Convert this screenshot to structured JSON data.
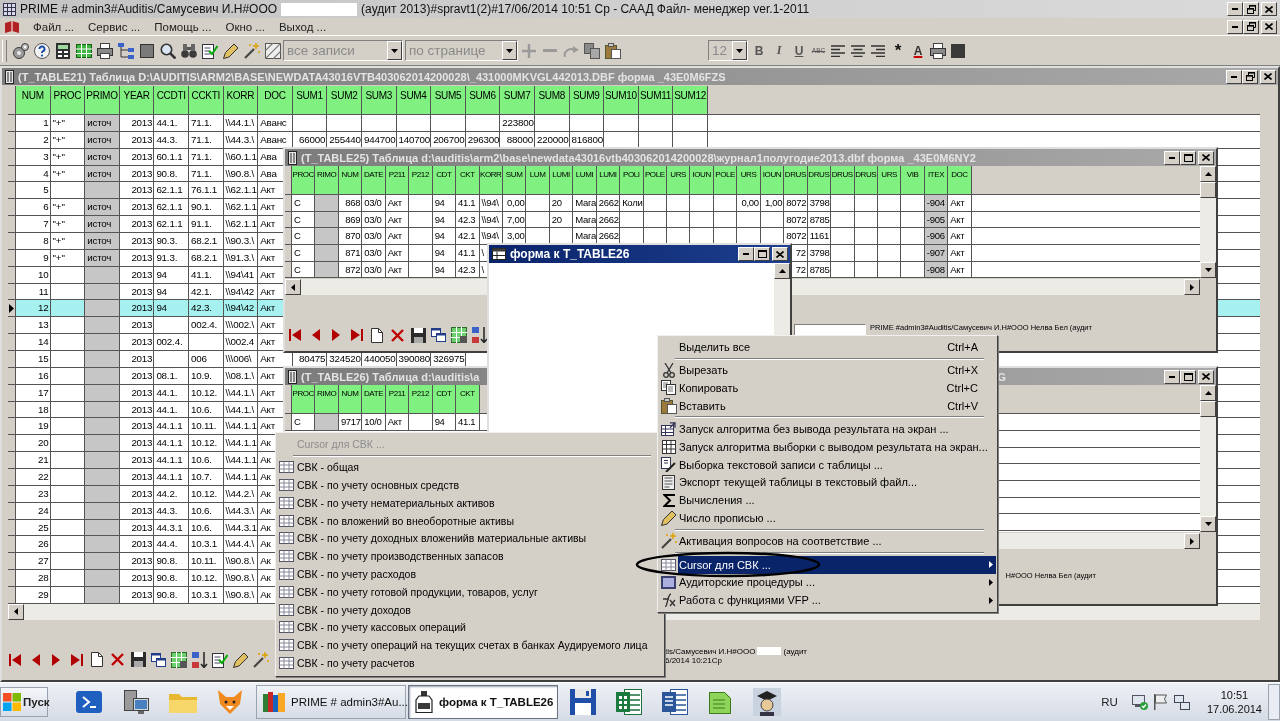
{
  "app": {
    "title_parts": [
      "PRIME # admin3#Auditis/Самусевич И.Н#ООО",
      "(аудит 2013)#spravt1(2)#17/06/2014 10:51 Ср - СААД Файл- менеджер ver.1-2011"
    ],
    "menu": [
      "Файл ...",
      "Сервис ...",
      "Помощь ...",
      "Окно ...",
      "Выход ..."
    ],
    "toolbar": {
      "record_filter": {
        "value": "все записи",
        "disabled": true
      },
      "paging": {
        "value": "по странице",
        "disabled": true
      },
      "font_size": {
        "value": "12",
        "disabled": true
      },
      "format_buttons": [
        {
          "label": "B",
          "kind": "bold"
        },
        {
          "label": "I",
          "kind": "italic"
        },
        {
          "label": "U",
          "kind": "underline"
        },
        {
          "label": "ABC",
          "kind": "strikethrough"
        }
      ],
      "symbol_button": "*",
      "font_color_button": "A"
    }
  },
  "table21": {
    "title": "(T_TABLE21) Таблица D:\\AUDITIS\\ARM2\\BASE\\NEWDATA43016VTB403062014200028\\_431000MKVGL442013.DBF форма _43E0M6FZS",
    "columns": [
      {
        "label": "NUM",
        "kind": "number"
      },
      {
        "label": "PROC",
        "kind": "text"
      },
      {
        "label": "PRIMO",
        "kind": "locked"
      },
      {
        "label": "YEAR",
        "kind": "number"
      },
      {
        "label": "CCDTI",
        "kind": "text"
      },
      {
        "label": "CCKTI",
        "kind": "text"
      },
      {
        "label": "KORR",
        "kind": "text"
      },
      {
        "label": "DOC",
        "kind": "text"
      },
      {
        "label": "SUM1",
        "kind": "number"
      },
      {
        "label": "SUM2",
        "kind": "number"
      },
      {
        "label": "SUM3",
        "kind": "number"
      },
      {
        "label": "SUM4",
        "kind": "number"
      },
      {
        "label": "SUM5",
        "kind": "number"
      },
      {
        "label": "SUM6",
        "kind": "number"
      },
      {
        "label": "SUM7",
        "kind": "number"
      },
      {
        "label": "SUM8",
        "kind": "number"
      },
      {
        "label": "SUM9",
        "kind": "number"
      },
      {
        "label": "SUM10",
        "kind": "number"
      },
      {
        "label": "SUM11",
        "kind": "number"
      },
      {
        "label": "SUM12",
        "kind": "number"
      }
    ],
    "rows": [
      {
        "selected": false,
        "cells": [
          "1",
          "\"+\"",
          "источ",
          "2013",
          "44.1.",
          "71.1.",
          "\\\\44.1.\\",
          "Аванс",
          "",
          "",
          "",
          "",
          "",
          "",
          "223800",
          "",
          "",
          "",
          "",
          ""
        ]
      },
      {
        "selected": false,
        "cells": [
          "2",
          "\"+\"",
          "источ",
          "2013",
          "44.3.",
          "71.1.",
          "\\\\44.3.\\",
          "Аванс",
          "66000",
          "255440",
          "944700",
          "140700",
          "206700",
          "296300",
          "88000",
          "220000",
          "816800",
          "",
          "",
          ""
        ]
      },
      {
        "selected": false,
        "cells": [
          "3",
          "\"+\"",
          "источ",
          "2013",
          "60.1.1",
          "71.1.",
          "\\\\60.1.1",
          "Ава",
          "",
          "",
          "",
          "",
          "",
          "",
          "",
          "",
          "",
          "",
          "",
          ""
        ]
      },
      {
        "selected": false,
        "cells": [
          "4",
          "\"+\"",
          "источ",
          "2013",
          "90.8.",
          "71.1.",
          "\\\\90.8.\\",
          "Ава",
          "",
          "",
          "",
          "",
          "",
          "",
          "",
          "",
          "",
          "",
          "",
          ""
        ]
      },
      {
        "selected": false,
        "cells": [
          "5",
          "",
          "",
          "2013",
          "62.1.1",
          "76.1.1",
          "\\\\62.1.1",
          "Акт",
          "",
          "",
          "",
          "",
          "",
          "",
          "",
          "",
          "",
          "",
          "",
          ""
        ]
      },
      {
        "selected": false,
        "cells": [
          "6",
          "\"+\"",
          "источ",
          "2013",
          "62.1.1",
          "90.1.",
          "\\\\62.1.1",
          "Акт",
          "",
          "",
          "",
          "",
          "",
          "",
          "",
          "",
          "",
          "",
          "",
          ""
        ]
      },
      {
        "selected": false,
        "cells": [
          "7",
          "\"+\"",
          "источ",
          "2013",
          "62.1.1",
          "91.1.",
          "\\\\62.1.1",
          "Акт",
          "",
          "",
          "",
          "",
          "",
          "",
          "",
          "",
          "",
          "",
          "",
          ""
        ]
      },
      {
        "selected": false,
        "cells": [
          "8",
          "\"+\"",
          "источ",
          "2013",
          "90.3.",
          "68.2.1",
          "\\\\90.3.\\",
          "Акт",
          "",
          "",
          "",
          "",
          "",
          "",
          "",
          "",
          "",
          "",
          "",
          ""
        ]
      },
      {
        "selected": false,
        "cells": [
          "9",
          "\"+\"",
          "источ",
          "2013",
          "91.3.",
          "68.2.1",
          "\\\\91.3.\\",
          "Акт",
          "",
          "",
          "",
          "",
          "",
          "",
          "",
          "",
          "",
          "",
          "",
          ""
        ]
      },
      {
        "selected": false,
        "cells": [
          "10",
          "",
          "",
          "2013",
          "94",
          "41.1.",
          "\\\\94\\41",
          "Акт",
          "",
          "",
          "",
          "",
          "",
          "",
          "",
          "",
          "",
          "",
          "",
          ""
        ]
      },
      {
        "selected": false,
        "cells": [
          "11",
          "",
          "",
          "2013",
          "94",
          "42.1.",
          "\\\\94\\42",
          "Акт",
          "",
          "",
          "",
          "",
          "",
          "",
          "",
          "",
          "",
          "",
          "",
          ""
        ]
      },
      {
        "selected": true,
        "cells": [
          "12",
          "",
          "",
          "2013",
          "94",
          "42.3.",
          "\\\\94\\42",
          "Акт",
          "",
          "",
          "",
          "",
          "",
          "",
          "",
          "",
          "",
          "",
          "",
          ""
        ]
      },
      {
        "selected": false,
        "cells": [
          "13",
          "",
          "",
          "2013",
          "",
          "002.4.",
          "\\\\\\002.\\",
          "Акт",
          "",
          "",
          "",
          "",
          "",
          "",
          "",
          "",
          "",
          "",
          "",
          ""
        ]
      },
      {
        "selected": false,
        "cells": [
          "14",
          "",
          "",
          "2013",
          "002.4.",
          "",
          "\\\\002.4",
          "Акт",
          "",
          "",
          "",
          "",
          "",
          "",
          "",
          "",
          "",
          "",
          "",
          ""
        ]
      },
      {
        "selected": false,
        "cells": [
          "15",
          "",
          "",
          "2013",
          "",
          "006",
          "\\\\\\006\\",
          "Акт",
          "80475",
          "324520",
          "440050",
          "390080",
          "326975",
          "",
          "",
          "",
          "",
          "",
          "",
          ""
        ]
      },
      {
        "selected": false,
        "cells": [
          "16",
          "",
          "",
          "2013",
          "08.1.",
          "10.9.",
          "\\\\08.1.\\",
          "Акт",
          "",
          "",
          "",
          "",
          "",
          "",
          "",
          "",
          "",
          "",
          "",
          ""
        ]
      },
      {
        "selected": false,
        "cells": [
          "17",
          "",
          "",
          "2013",
          "44.1.",
          "10.12.",
          "\\\\44.1.\\",
          "Акт",
          "",
          "",
          "",
          "",
          "",
          "",
          "",
          "",
          "",
          "",
          "",
          ""
        ]
      },
      {
        "selected": false,
        "cells": [
          "18",
          "",
          "",
          "2013",
          "44.1.",
          "10.6.",
          "\\\\44.1.\\",
          "Акт",
          "",
          "",
          "",
          "",
          "",
          "",
          "",
          "",
          "",
          "",
          "",
          ""
        ]
      },
      {
        "selected": false,
        "cells": [
          "19",
          "",
          "",
          "2013",
          "44.1.1",
          "10.11.",
          "\\\\44.1.1",
          "Акт",
          "",
          "",
          "",
          "",
          "",
          "",
          "",
          "",
          "",
          "",
          "",
          ""
        ]
      },
      {
        "selected": false,
        "cells": [
          "20",
          "",
          "",
          "2013",
          "44.1.1",
          "10.12.",
          "\\\\44.1.1",
          "Ак",
          "",
          "",
          "",
          "",
          "",
          "",
          "",
          "",
          "",
          "",
          "",
          ""
        ]
      },
      {
        "selected": false,
        "cells": [
          "21",
          "",
          "",
          "2013",
          "44.1.1",
          "10.6.",
          "\\\\44.1.1",
          "Ак",
          "",
          "",
          "",
          "",
          "",
          "",
          "",
          "",
          "",
          "",
          "",
          ""
        ]
      },
      {
        "selected": false,
        "cells": [
          "22",
          "",
          "",
          "2013",
          "44.1.1",
          "10.7.",
          "\\\\44.1.1",
          "Ак",
          "",
          "",
          "",
          "",
          "",
          "",
          "",
          "",
          "",
          "",
          "",
          ""
        ]
      },
      {
        "selected": false,
        "cells": [
          "23",
          "",
          "",
          "2013",
          "44.2.",
          "10.12.",
          "\\\\44.2.\\",
          "Ак",
          "",
          "",
          "",
          "",
          "",
          "",
          "",
          "",
          "",
          "",
          "",
          ""
        ]
      },
      {
        "selected": false,
        "cells": [
          "24",
          "",
          "",
          "2013",
          "44.3.",
          "10.6.",
          "\\\\44.3.\\",
          "Ак",
          "",
          "",
          "",
          "",
          "",
          "",
          "",
          "",
          "",
          "",
          "",
          ""
        ]
      },
      {
        "selected": false,
        "cells": [
          "25",
          "",
          "",
          "2013",
          "44.3.1",
          "10.6.",
          "\\\\44.3.1",
          "Ак",
          "",
          "",
          "",
          "",
          "",
          "",
          "",
          "",
          "",
          "",
          "",
          ""
        ]
      },
      {
        "selected": false,
        "cells": [
          "26",
          "",
          "",
          "2013",
          "44.4.",
          "10.3.1",
          "\\\\44.4.\\",
          "Ак",
          "",
          "",
          "",
          "",
          "",
          "",
          "",
          "",
          "",
          "",
          "",
          ""
        ]
      },
      {
        "selected": false,
        "cells": [
          "27",
          "",
          "",
          "2013",
          "90.8.",
          "10.11.",
          "\\\\90.8.\\",
          "Ак",
          "",
          "",
          "",
          "",
          "",
          "",
          "",
          "",
          "",
          "",
          "",
          ""
        ]
      },
      {
        "selected": false,
        "cells": [
          "28",
          "",
          "",
          "2013",
          "90.8.",
          "10.12.",
          "\\\\90.8.\\",
          "Ак",
          "",
          "",
          "",
          "",
          "",
          "",
          "",
          "",
          "",
          "",
          "",
          ""
        ]
      },
      {
        "selected": false,
        "cells": [
          "29",
          "",
          "",
          "2013",
          "90.8.",
          "10.3.1",
          "\\\\90.8.\\",
          "Ак",
          "",
          "",
          "",
          "",
          "",
          "",
          "",
          "",
          "",
          "",
          "",
          ""
        ]
      }
    ],
    "status_parts": [
      "tis/Самусевич И.Н#ООО",
      "(аудит",
      "6/2014 10:21Ср"
    ]
  },
  "table25": {
    "title": "(T_TABLE25) Таблица d:\\auditis\\arm2\\base\\newdata43016vtb403062014200028\\журнал1полугодие2013.dbf форма _43E0M6NY2",
    "columns": [
      {
        "label": "PROC",
        "kind": "text"
      },
      {
        "label": "RIMO",
        "kind": "locked"
      },
      {
        "label": "NUM",
        "kind": "number"
      },
      {
        "label": "DATE",
        "kind": "text"
      },
      {
        "label": "P211",
        "kind": "text"
      },
      {
        "label": "P212",
        "kind": "text"
      },
      {
        "label": "CDT",
        "kind": "text"
      },
      {
        "label": "CKT",
        "kind": "text"
      },
      {
        "label": "KORR",
        "kind": "text"
      },
      {
        "label": "SUM",
        "kind": "number"
      },
      {
        "label": "LUM",
        "kind": "text"
      },
      {
        "label": "LUMI",
        "kind": "text"
      },
      {
        "label": "LUMI",
        "kind": "text"
      },
      {
        "label": "LUMI",
        "kind": "text"
      },
      {
        "label": "POLI",
        "kind": "text"
      },
      {
        "label": "POLE",
        "kind": "text"
      },
      {
        "label": "URS",
        "kind": "text"
      },
      {
        "label": "IOUN",
        "kind": "text"
      },
      {
        "label": "POLE",
        "kind": "text"
      },
      {
        "label": "URS",
        "kind": "number"
      },
      {
        "label": "IOUN",
        "kind": "number"
      },
      {
        "label": "DRUS",
        "kind": "number"
      },
      {
        "label": "DRUS",
        "kind": "number"
      },
      {
        "label": "DRUS",
        "kind": "number"
      },
      {
        "label": "DRUS",
        "kind": "number"
      },
      {
        "label": "URS",
        "kind": "text"
      },
      {
        "label": "VIB",
        "kind": "text"
      },
      {
        "label": "ITEX",
        "kind": "locked"
      },
      {
        "label": "DOC",
        "kind": "text"
      }
    ],
    "rows": [
      [
        "С",
        "",
        "868",
        "03/0",
        "Акт",
        "",
        "94",
        "41.1",
        "\\\\94\\",
        "0,00",
        "",
        "20",
        "Мага",
        "2662",
        "Коли",
        "",
        "",
        "",
        "",
        "0,00",
        "1,00",
        "8072",
        "3798",
        "",
        "",
        "",
        "",
        "-904",
        "Акт"
      ],
      [
        "С",
        "",
        "869",
        "03/0",
        "Акт",
        "",
        "94",
        "42.3",
        "\\\\94\\",
        "7,00",
        "",
        "20",
        "Мага",
        "2662",
        "",
        "",
        "",
        "",
        "",
        "",
        "",
        "8072",
        "8785",
        "",
        "",
        "",
        "",
        "-905",
        "Акт"
      ],
      [
        "С",
        "",
        "870",
        "03/0",
        "Акт",
        "",
        "94",
        "42.1",
        "\\\\94\\",
        "3,00",
        "",
        "",
        "Мага",
        "2662",
        "",
        "",
        "",
        "",
        "",
        "",
        "",
        "8072",
        "1161",
        "",
        "",
        "",
        "",
        "-906",
        "Акт"
      ],
      [
        "С",
        "",
        "871",
        "03/0",
        "Акт",
        "",
        "94",
        "41.1",
        "\\",
        "",
        "",
        "",
        "",
        "",
        "",
        "",
        "",
        "",
        "",
        "",
        "",
        "72",
        "3798",
        "",
        "",
        "",
        "",
        "-907",
        "Акт"
      ],
      [
        "С",
        "",
        "872",
        "03/0",
        "Акт",
        "",
        "94",
        "42.3",
        "\\",
        "",
        "",
        "",
        "",
        "",
        "",
        "",
        "",
        "",
        "",
        "",
        "",
        "72",
        "8785",
        "",
        "",
        "",
        "",
        "-908",
        "Акт"
      ]
    ],
    "status": "PRIME #admin3#Auditis/Самусевич И.Н#ООО Нелва Бел (аудит"
  },
  "table26": {
    "title_parts": [
      "(T_TABLE26) Таблица d:\\auditis\\a",
      "G"
    ],
    "columns": [
      {
        "label": "PROC",
        "kind": "text"
      },
      {
        "label": "RIMO",
        "kind": "locked"
      },
      {
        "label": "NUM",
        "kind": "number"
      },
      {
        "label": "DATE",
        "kind": "text"
      },
      {
        "label": "P211",
        "kind": "text"
      },
      {
        "label": "P212",
        "kind": "text"
      },
      {
        "label": "CDT",
        "kind": "text"
      },
      {
        "label": "CKT",
        "kind": "text"
      }
    ],
    "rows": [
      [
        "С",
        "",
        "9717",
        "10/0",
        "Акт",
        "",
        "94",
        "41.1"
      ]
    ],
    "status": "Н#ООО Нелва Бел (аудит"
  },
  "form": {
    "title": "форма к T_TABLE26"
  },
  "context_menu": {
    "items": [
      {
        "kind": "item",
        "label": "Выделить все",
        "shortcut": "Ctrl+A",
        "selected": false,
        "submenu": false
      },
      {
        "kind": "separator"
      },
      {
        "kind": "item",
        "label": "Вырезать",
        "shortcut": "Ctrl+X",
        "selected": false,
        "submenu": false
      },
      {
        "kind": "item",
        "label": "Копировать",
        "shortcut": "Ctrl+C",
        "selected": false,
        "submenu": false
      },
      {
        "kind": "item",
        "label": "Вставить",
        "shortcut": "Ctrl+V",
        "selected": false,
        "submenu": false
      },
      {
        "kind": "separator"
      },
      {
        "kind": "item",
        "label": "Запуск алгоритма без вывода результата на экран ...",
        "selected": false,
        "submenu": false
      },
      {
        "kind": "item",
        "label": "Запуск алгоритма выборки с выводом результата на экран...",
        "selected": false,
        "submenu": false
      },
      {
        "kind": "item",
        "label": "Выборка текстовой записи с таблицы ...",
        "selected": false,
        "submenu": false
      },
      {
        "kind": "item",
        "label": "Экспорт текущей таблицы в текстовый файл...",
        "selected": false,
        "submenu": false
      },
      {
        "kind": "item",
        "label": "Вычисления ...",
        "selected": false,
        "submenu": false
      },
      {
        "kind": "item",
        "label": "Число прописью ...",
        "selected": false,
        "submenu": false
      },
      {
        "kind": "separator"
      },
      {
        "kind": "item",
        "label": "Активация вопросов на соответствие ...",
        "selected": false,
        "submenu": false
      },
      {
        "kind": "separator"
      },
      {
        "kind": "item",
        "label": "Cursor для СВК ...",
        "selected": true,
        "submenu": true
      },
      {
        "kind": "item",
        "label": "Аудиторские процедуры ...",
        "selected": false,
        "submenu": true
      },
      {
        "kind": "item",
        "label": "Работа с функциями VFP ...",
        "selected": false,
        "submenu": true
      }
    ]
  },
  "submenu": {
    "items": [
      {
        "kind": "header",
        "label": "Cursor для СВК ..."
      },
      {
        "kind": "separator"
      },
      {
        "kind": "item",
        "label": "СВК - общая"
      },
      {
        "kind": "item",
        "label": "СВК - по учету основных средств"
      },
      {
        "kind": "item",
        "label": "СВК - по учету нематериальных активов"
      },
      {
        "kind": "item",
        "label": "СВК - по вложений во внеоборотные активы"
      },
      {
        "kind": "item",
        "label": "СВК - по учету доходных вложенийв материальные активы"
      },
      {
        "kind": "item",
        "label": "СВК - по учету производственных запасов"
      },
      {
        "kind": "item",
        "label": "СВК - по учету расходов"
      },
      {
        "kind": "item",
        "label": "СВК - по учету готовой продукции, товаров, услуг"
      },
      {
        "kind": "item",
        "label": "СВК - по учету доходов"
      },
      {
        "kind": "item",
        "label": "СВК - по учету кассовых операций"
      },
      {
        "kind": "item",
        "label": "СВК - по учету операций на текущих счетах в банках Аудируемого лица"
      },
      {
        "kind": "item",
        "label": "СВК - по учету расчетов"
      }
    ]
  },
  "taskbar": {
    "start_button": "Пуск",
    "tasks": [
      {
        "label": "PRIME # admin3#Au...",
        "selected": false
      },
      {
        "label": "форма к T_TABLE26",
        "selected": true
      }
    ],
    "language": "RU",
    "clock": {
      "time": "10:51",
      "date": "17.06.2014"
    }
  }
}
